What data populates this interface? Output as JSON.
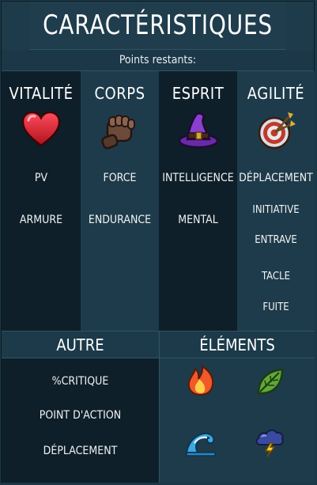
{
  "title": "CARACTÉRISTIQUES",
  "points_label": "Points restants:",
  "columns": [
    {
      "name": "VITALITÉ",
      "icon": "heart-icon",
      "stats": [
        "PV",
        "ARMURE"
      ]
    },
    {
      "name": "CORPS",
      "icon": "fist-icon",
      "stats": [
        "FORCE",
        "ENDURANCE"
      ]
    },
    {
      "name": "ESPRIT",
      "icon": "wizard-hat-icon",
      "stats": [
        "INTELLIGENCE",
        "MENTAL"
      ]
    },
    {
      "name": "AGILITÉ",
      "icon": "target-arrows-icon",
      "stats": [
        "DÉPLACEMENT",
        "INITIATIVE",
        "ENTRAVE",
        "TACLE",
        "FUITE"
      ]
    }
  ],
  "autre": {
    "title": "AUTRE",
    "stats": [
      "%CRITIQUE",
      "POINT D'ACTION",
      "DÉPLACEMENT"
    ]
  },
  "elements": {
    "title": "ÉLÉMENTS",
    "icons": [
      "fire-icon",
      "leaf-icon",
      "water-wave-icon",
      "storm-cloud-icon"
    ]
  }
}
